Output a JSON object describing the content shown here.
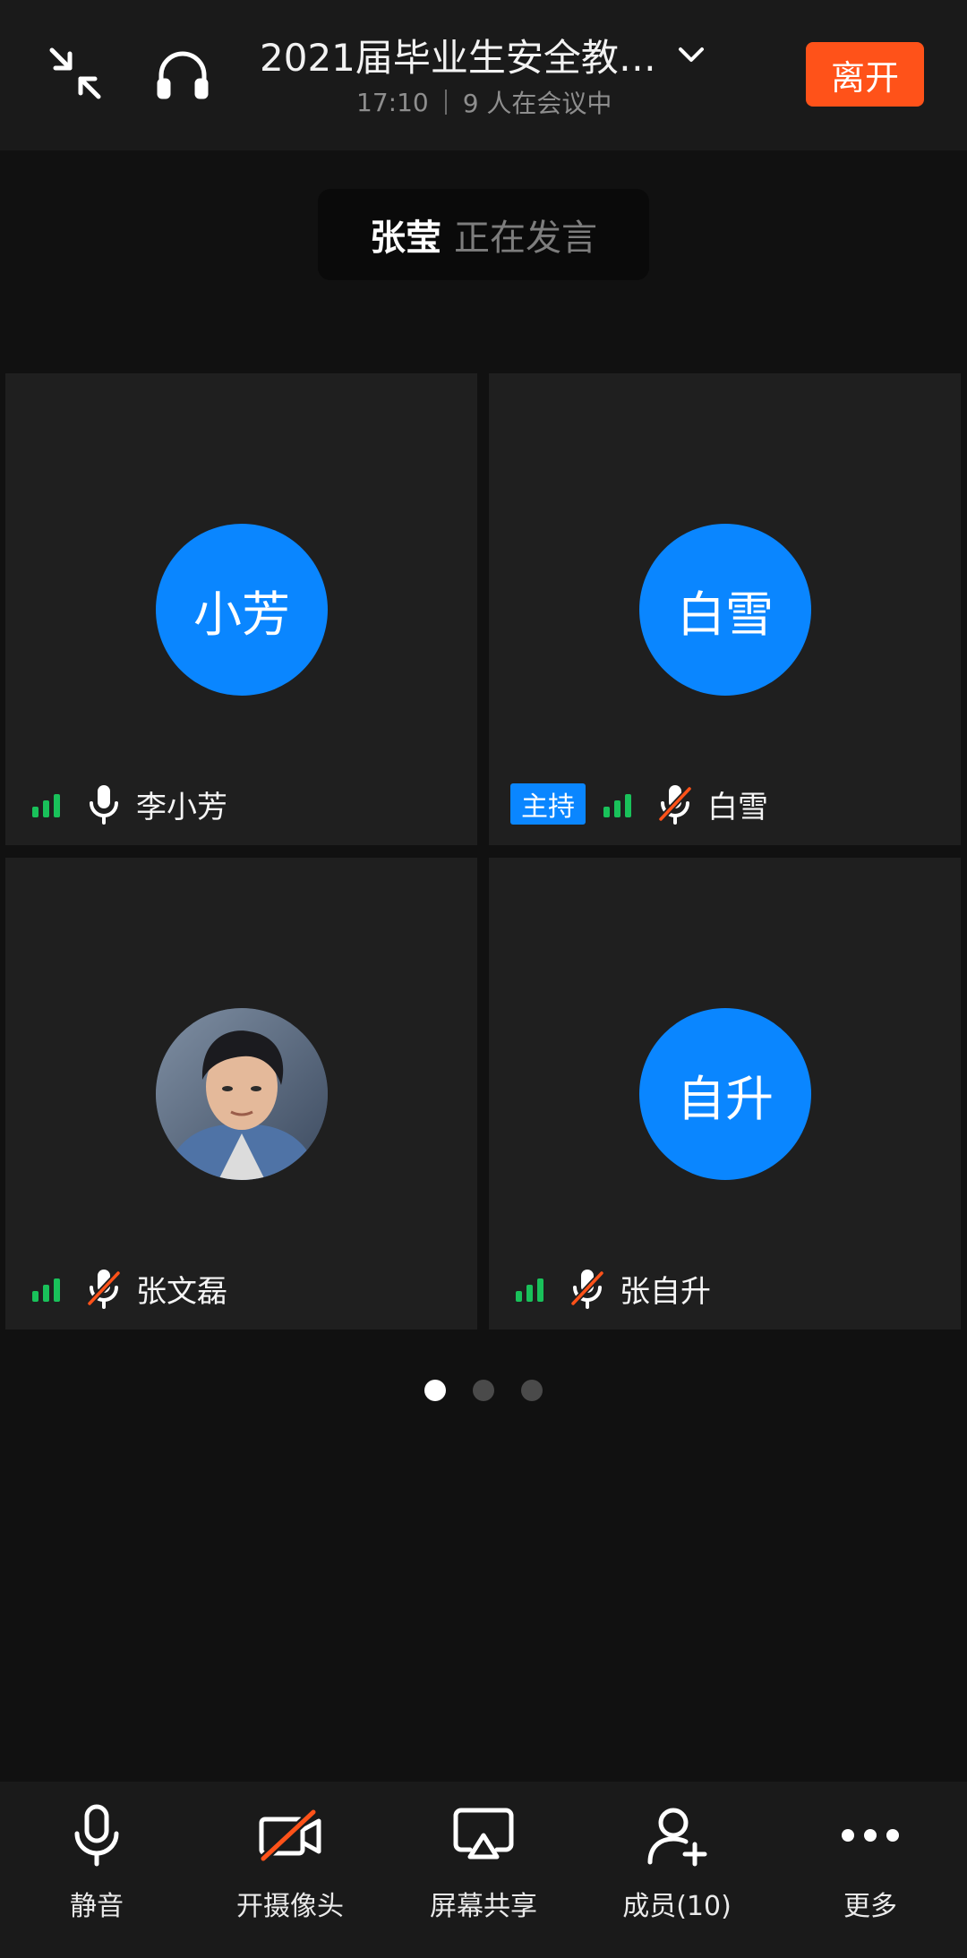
{
  "header": {
    "meeting_title": "2021届毕业生安全教…",
    "time": "17:10",
    "participants": "9 人在会议中",
    "leave_label": "离开",
    "icons": [
      "minimize-icon",
      "headphones-icon",
      "chevron-down-icon"
    ]
  },
  "speaker_banner": {
    "name": "张莹",
    "status": "正在发言"
  },
  "tiles": [
    {
      "avatar_text": "小芳",
      "name": "李小芳",
      "mic": "on",
      "host": false
    },
    {
      "avatar_text": "白雪",
      "name": "白雪",
      "mic": "muted",
      "host": true,
      "host_label": "主持"
    },
    {
      "avatar_text": "",
      "name": "张文磊",
      "mic": "muted",
      "host": false,
      "avatar_type": "photo"
    },
    {
      "avatar_text": "自升",
      "name": "张自升",
      "mic": "muted",
      "host": false
    }
  ],
  "pagination": {
    "pages": 3,
    "current": 1
  },
  "toolbar": {
    "mute_label": "静音",
    "camera_label": "开摄像头",
    "share_label": "屏幕共享",
    "members_label": "成员(10)",
    "more_label": "更多"
  },
  "colors": {
    "accent": "#0a86ff",
    "leave": "#ff5219",
    "signal": "#19c15a",
    "muted_slash": "#ff5219"
  }
}
